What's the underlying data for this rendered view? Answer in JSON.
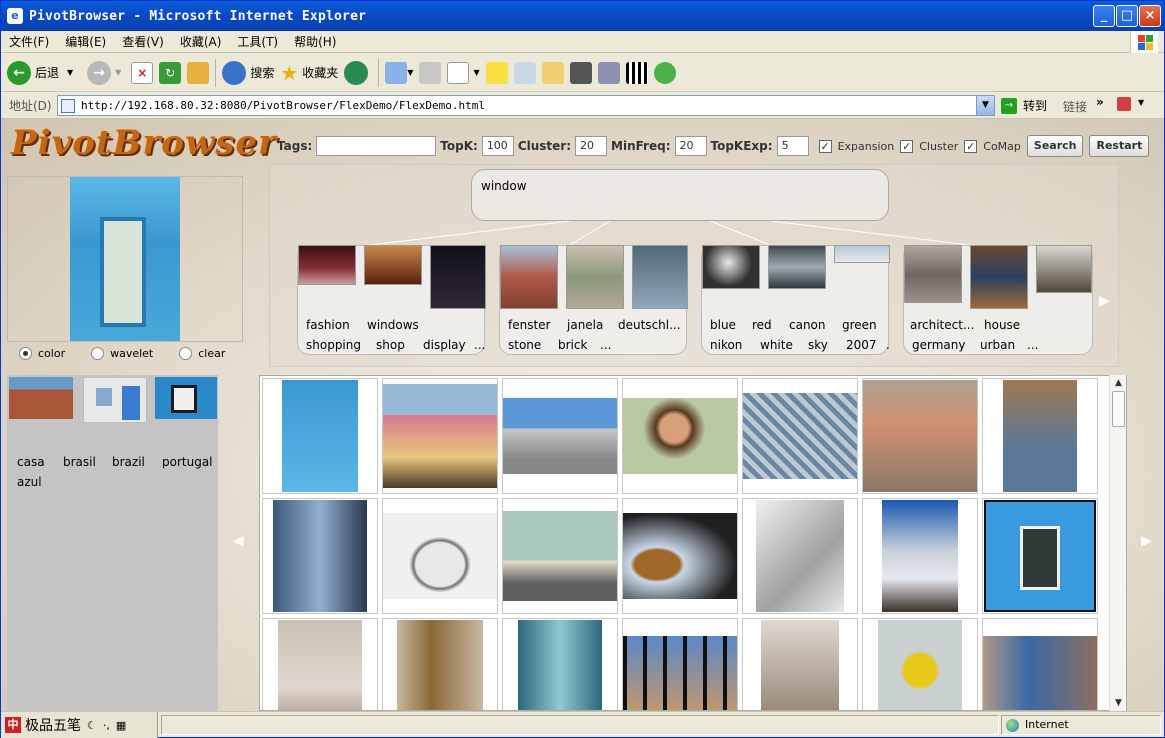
{
  "window": {
    "title": "PivotBrowser - Microsoft Internet Explorer"
  },
  "menu": [
    "文件(F)",
    "编辑(E)",
    "查看(V)",
    "收藏(A)",
    "工具(T)",
    "帮助(H)"
  ],
  "toolbar": {
    "back": "后退",
    "search": "搜索",
    "favorites": "收藏夹"
  },
  "address": {
    "label": "地址(D)",
    "url": "http://192.168.80.32:8080/PivotBrowser/FlexDemo/FlexDemo.html",
    "go": "转到",
    "links": "链接"
  },
  "app": {
    "logo": "PivotBrowser",
    "controls": {
      "tags_label": "Tags:",
      "tags_value": "",
      "topk_label": "TopK:",
      "topk_value": "100",
      "cluster_label": "Cluster:",
      "cluster_value": "20",
      "minfreq_label": "MinFreq:",
      "minfreq_value": "20",
      "topkexp_label": "TopKExp:",
      "topkexp_value": "5",
      "expansion": "Expansion",
      "cluster_cb": "Cluster",
      "comap": "CoMap",
      "search_btn": "Search",
      "restart_btn": "Restart"
    },
    "radios": {
      "color": "color",
      "wavelet": "wavelet",
      "clear": "clear",
      "selected": "color"
    },
    "root_tag": "window",
    "clusters": [
      {
        "row1": [
          "fashion",
          "windows"
        ],
        "row2": [
          "shopping",
          "shop",
          "display",
          "..."
        ]
      },
      {
        "row1": [
          "fenster",
          "janela",
          "deutschl..."
        ],
        "row2": [
          "stone",
          "brick",
          "..."
        ]
      },
      {
        "row1": [
          "blue",
          "red",
          "canon",
          "green"
        ],
        "row2": [
          "nikon",
          "white",
          "sky",
          "2007",
          "."
        ]
      },
      {
        "row1": [
          "architect...",
          "house"
        ],
        "row2": [
          "germany",
          "urban",
          "..."
        ]
      }
    ],
    "selected_tags": [
      "casa",
      "brasil",
      "brazil",
      "portugal",
      "azul"
    ]
  },
  "status": {
    "ime": "极品五笔",
    "zone": "Internet"
  },
  "colors": {
    "title_blue": "#0a50c8",
    "accent_orange": "#c06818",
    "panel_bg": "#e3dbcc"
  }
}
